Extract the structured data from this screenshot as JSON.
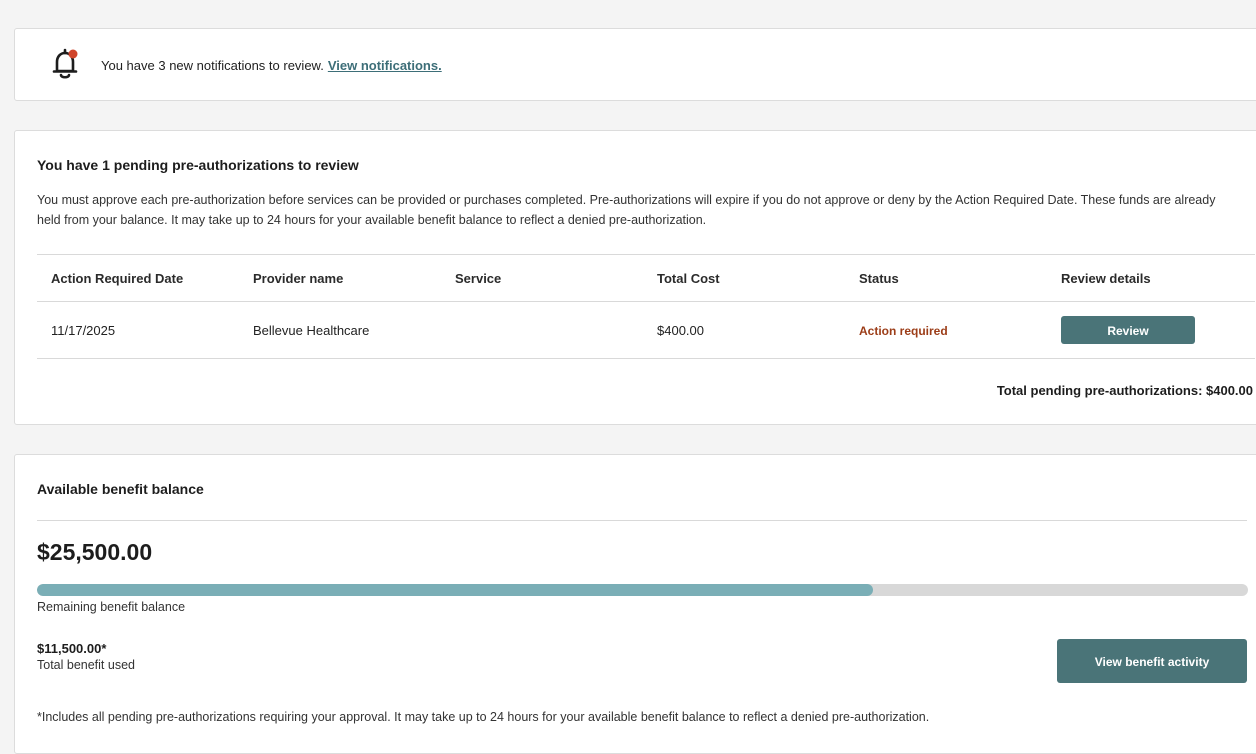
{
  "notification": {
    "text": "You have 3 new notifications to review.",
    "link": "View notifications.",
    "badge_color": "#d0452b"
  },
  "pending": {
    "title": "You have 1 pending pre-authorizations to review",
    "description": "You must approve each pre-authorization before services can be provided or purchases completed. Pre-authorizations will expire if you do not approve or deny by the Action Required Date. These funds are already held from your balance. It may take up to 24 hours for your available benefit balance to reflect a denied pre-authorization.",
    "columns": [
      "Action Required Date",
      "Provider name",
      "Service",
      "Total Cost",
      "Status",
      "Review details"
    ],
    "rows": [
      {
        "date": "11/17/2025",
        "provider": "Bellevue Healthcare",
        "service": "",
        "cost": "$400.00",
        "status": "Action required",
        "action": "Review"
      }
    ],
    "total": "Total pending pre-authorizations: $400.00"
  },
  "balance": {
    "title": "Available benefit balance",
    "amount": "$25,500.00",
    "progress_fraction": 0.69,
    "remaining_label": "Remaining benefit balance",
    "used_amount": "$11,500.00*",
    "used_label": "Total benefit used",
    "activity_button": "View benefit activity",
    "footnote": "*Includes all pending pre-authorizations requiring your approval. It may take up to 24 hours for your available benefit balance to reflect a denied pre-authorization."
  },
  "colors": {
    "accent": "#4a7478",
    "progress": "#7aaeb6",
    "status_action": "#9c3d18"
  }
}
